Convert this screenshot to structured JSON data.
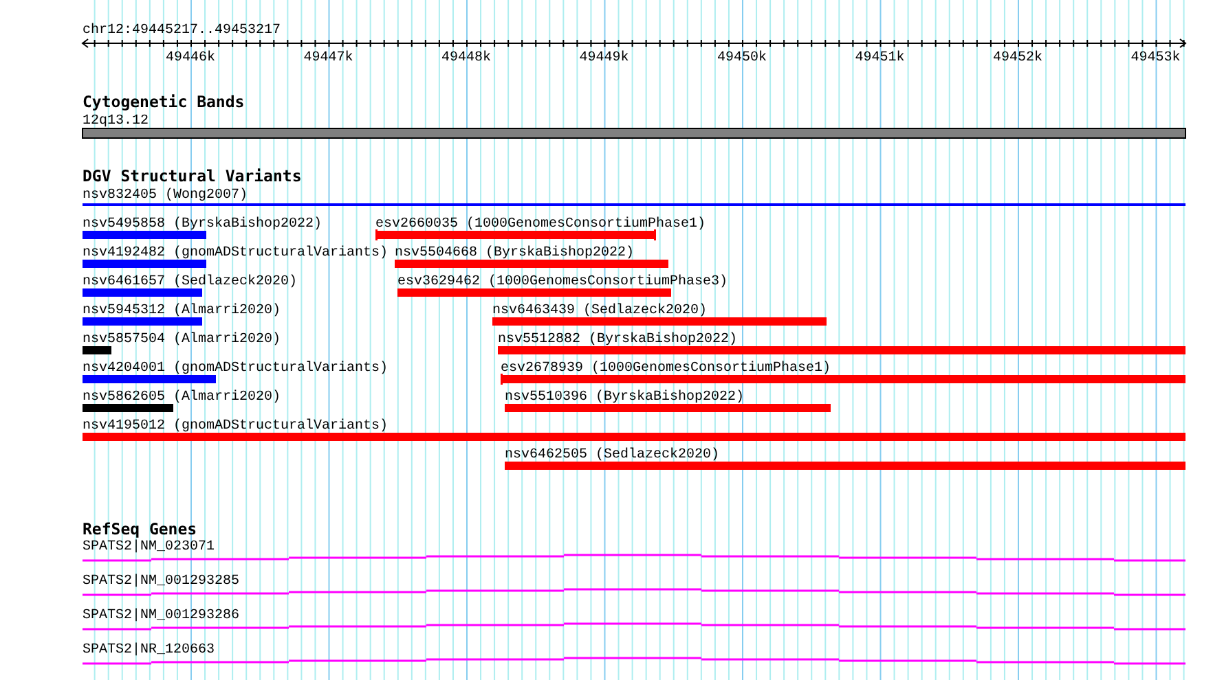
{
  "location": "chr12:49445217..49453217",
  "ruler": {
    "ticks": [
      {
        "label": "49446k"
      },
      {
        "label": "49447k"
      },
      {
        "label": "49448k"
      },
      {
        "label": "49449k"
      },
      {
        "label": "49450k"
      },
      {
        "label": "49451k"
      },
      {
        "label": "49452k"
      },
      {
        "label": "49453k"
      }
    ]
  },
  "cytogenetic_bands": {
    "title": "Cytogenetic Bands",
    "bands": [
      {
        "label": "12q13.12"
      }
    ]
  },
  "structural_variants": {
    "title": "DGV Structural Variants",
    "features": [
      {
        "label": "nsv832405 (Wong2007)",
        "color": "#0000ff",
        "kind": "line"
      },
      {
        "label": "nsv5495858 (ByrskaBishop2022)",
        "color": "#0000ff",
        "kind": "bar"
      },
      {
        "label": "esv2660035 (1000GenomesConsortiumPhase1)",
        "color": "#ff0000",
        "kind": "capped"
      },
      {
        "label": "nsv4192482 (gnomADStructuralVariants)",
        "color": "#0000ff",
        "kind": "bar"
      },
      {
        "label": "nsv5504668 (ByrskaBishop2022)",
        "color": "#ff0000",
        "kind": "bar"
      },
      {
        "label": "nsv6461657 (Sedlazeck2020)",
        "color": "#0000ff",
        "kind": "bar"
      },
      {
        "label": "esv3629462 (1000GenomesConsortiumPhase3)",
        "color": "#ff0000",
        "kind": "bar"
      },
      {
        "label": "nsv5945312 (Almarri2020)",
        "color": "#0000ff",
        "kind": "bar"
      },
      {
        "label": "nsv6463439 (Sedlazeck2020)",
        "color": "#ff0000",
        "kind": "bar"
      },
      {
        "label": "nsv5857504 (Almarri2020)",
        "color": "#000000",
        "kind": "bar"
      },
      {
        "label": "nsv5512882 (ByrskaBishop2022)",
        "color": "#ff0000",
        "kind": "bar"
      },
      {
        "label": "nsv4204001 (gnomADStructuralVariants)",
        "color": "#0000ff",
        "kind": "bar"
      },
      {
        "label": "esv2678939 (1000GenomesConsortiumPhase1)",
        "color": "#ff0000",
        "kind": "capped"
      },
      {
        "label": "nsv5862605 (Almarri2020)",
        "color": "#000000",
        "kind": "bar"
      },
      {
        "label": "nsv5510396 (ByrskaBishop2022)",
        "color": "#ff0000",
        "kind": "bar"
      },
      {
        "label": "nsv4195012 (gnomADStructuralVariants)",
        "color": "#ff0000",
        "kind": "bar"
      },
      {
        "label": "nsv6462505 (Sedlazeck2020)",
        "color": "#ff0000",
        "kind": "bar"
      }
    ]
  },
  "refseq_genes": {
    "title": "RefSeq Genes",
    "transcripts": [
      {
        "label": "SPATS2|NM_023071"
      },
      {
        "label": "SPATS2|NM_001293285"
      },
      {
        "label": "SPATS2|NM_001293286"
      },
      {
        "label": "SPATS2|NR_120663"
      }
    ]
  }
}
